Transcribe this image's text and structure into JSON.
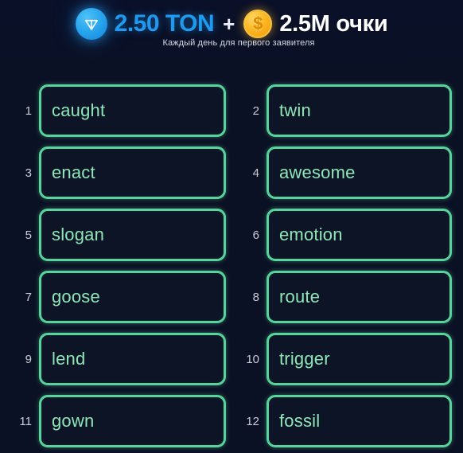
{
  "header": {
    "ton_icon": "ton-diamond-icon",
    "ton_amount": "2.50 TON",
    "plus": "+",
    "coin_icon": "dollar-coin-icon",
    "coin_symbol": "$",
    "points_amount": "2.5M очки",
    "subtitle": "Каждый день для первого заявителя",
    "colors": {
      "ton_blue": "#1e9af0",
      "points_white": "#ffffff",
      "coin_gold": "#fcb724",
      "background": "#0a1028"
    }
  },
  "grid": {
    "colors": {
      "card_border": "#57d49b",
      "word_text": "#8fe6b8",
      "index_text": "#c8cdd6",
      "card_background": "#0d1426"
    },
    "items": [
      {
        "index": "1",
        "word": "caught"
      },
      {
        "index": "2",
        "word": "twin"
      },
      {
        "index": "3",
        "word": "enact"
      },
      {
        "index": "4",
        "word": "awesome"
      },
      {
        "index": "5",
        "word": "slogan"
      },
      {
        "index": "6",
        "word": "emotion"
      },
      {
        "index": "7",
        "word": "goose"
      },
      {
        "index": "8",
        "word": "route"
      },
      {
        "index": "9",
        "word": "lend"
      },
      {
        "index": "10",
        "word": "trigger"
      },
      {
        "index": "11",
        "word": "gown"
      },
      {
        "index": "12",
        "word": "fossil"
      }
    ]
  }
}
